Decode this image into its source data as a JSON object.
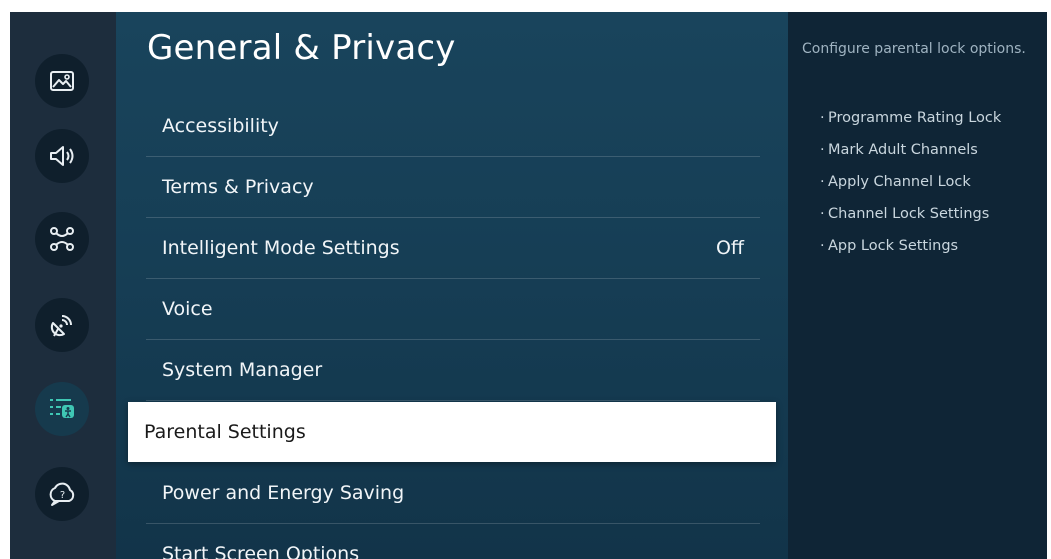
{
  "sidebar": {
    "icons": [
      {
        "name": "picture-icon"
      },
      {
        "name": "sound-icon"
      },
      {
        "name": "connection-icon"
      },
      {
        "name": "broadcasting-icon"
      },
      {
        "name": "general-privacy-icon"
      },
      {
        "name": "support-icon"
      }
    ],
    "active_index": 4
  },
  "main": {
    "title": "General & Privacy",
    "items": [
      {
        "label": "Accessibility",
        "value": ""
      },
      {
        "label": "Terms & Privacy",
        "value": ""
      },
      {
        "label": "Intelligent Mode Settings",
        "value": "Off"
      },
      {
        "label": "Voice",
        "value": ""
      },
      {
        "label": "System Manager",
        "value": ""
      },
      {
        "label": "Parental Settings",
        "value": ""
      },
      {
        "label": "Power and Energy Saving",
        "value": ""
      },
      {
        "label": "Start Screen Options",
        "value": ""
      }
    ],
    "focused_index": 5
  },
  "help": {
    "description": "Configure parental lock options.",
    "items": [
      "Programme Rating Lock",
      "Mark Adult Channels",
      "Apply Channel Lock",
      "Channel Lock Settings",
      "App Lock Settings"
    ]
  },
  "colors": {
    "background": "#0f2d44",
    "focus": "#ffffff",
    "accent": "#3fc7b4"
  }
}
